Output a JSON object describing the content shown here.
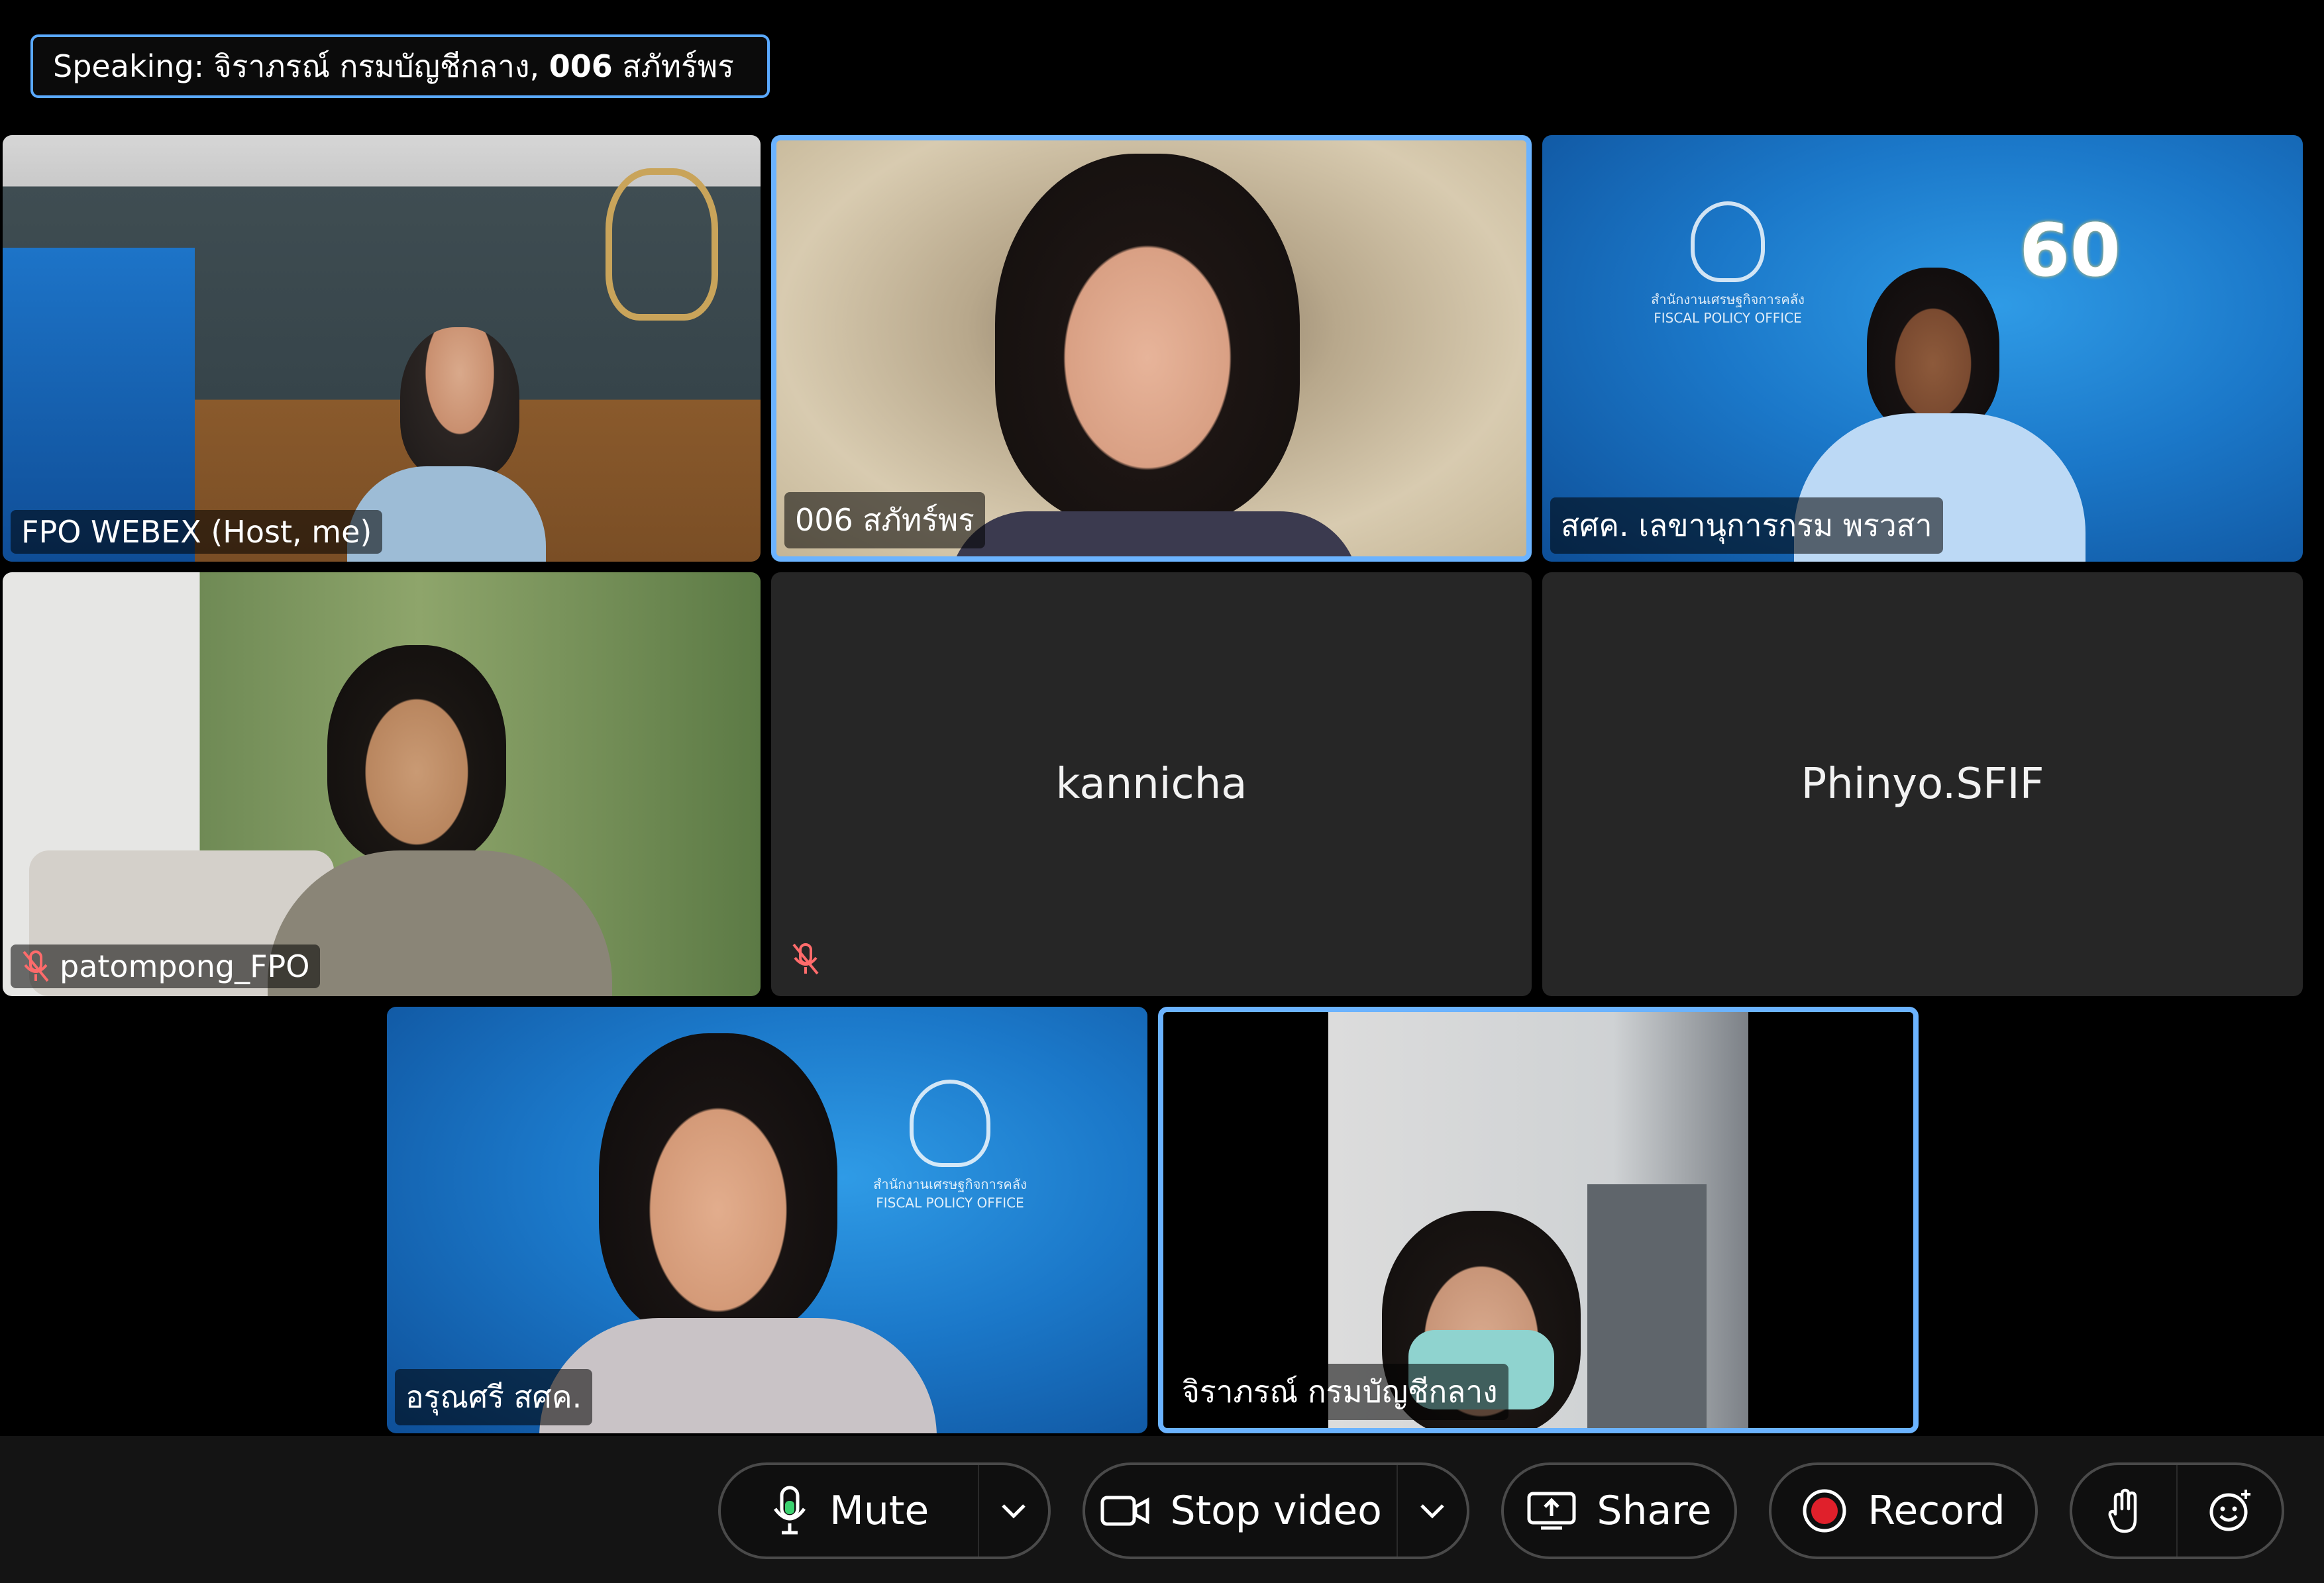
{
  "speaking": {
    "prefix": "Speaking:",
    "names": " จิราภรณ์ กรมบัญชีกลาง,",
    "bold_part": "006",
    "suffix": " สภัทร์พร"
  },
  "participants": [
    {
      "label": "FPO WEBEX (Host, me)",
      "muted": false,
      "video": true
    },
    {
      "label": "006 สภัทร์พร",
      "muted": false,
      "video": true,
      "active": true
    },
    {
      "label": "สศค. เลขานุการกรม พรวสา",
      "muted": false,
      "video": true
    },
    {
      "label": "patompong_FPO",
      "muted": true,
      "video": true
    },
    {
      "label": "kannicha",
      "muted": true,
      "video": false
    },
    {
      "label": "Phinyo.SFIF",
      "muted": false,
      "video": false
    },
    {
      "label": "อรุณศรี สศค.",
      "muted": false,
      "video": true
    },
    {
      "label": "จิราภรณ์ กรมบัญชีกลาง",
      "muted": false,
      "video": true,
      "active": true
    }
  ],
  "backdrop": {
    "agency_th": "สำนักงานเศรษฐกิจการคลัง",
    "agency_en": "FISCAL POLICY OFFICE",
    "anniversary": "60"
  },
  "toolbar": {
    "mute": "Mute",
    "stop_video": "Stop video",
    "share": "Share",
    "record": "Record"
  },
  "colors": {
    "accent": "#6bb3ff",
    "record_red": "#e0202b",
    "muted_red": "#ff6b6b"
  },
  "icons": {
    "mute": "microphone-icon",
    "video": "camera-icon",
    "share": "share-screen-icon",
    "record": "record-icon",
    "hand": "raise-hand-icon",
    "reactions": "emoji-icon",
    "dropdown": "chevron-down-icon",
    "muted": "mic-muted-icon"
  }
}
